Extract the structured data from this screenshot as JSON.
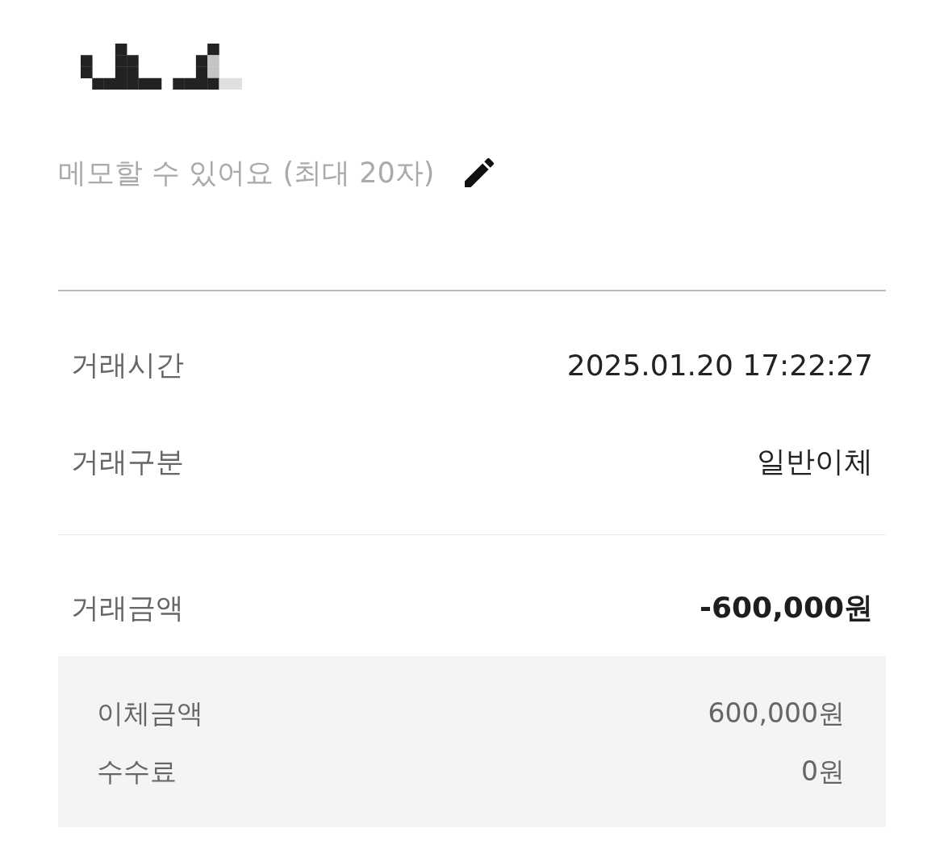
{
  "memo": {
    "placeholder": "메모할 수 있어요 (최대 20자)"
  },
  "details": [
    {
      "label": "거래시간",
      "value": "2025.01.20 17:22:27"
    },
    {
      "label": "거래구분",
      "value": "일반이체"
    }
  ],
  "amount": {
    "label": "거래금액",
    "value": "-600,000원"
  },
  "breakdown": [
    {
      "label": "이체금액",
      "value": "600,000원"
    },
    {
      "label": "수수료",
      "value": "0원"
    }
  ]
}
